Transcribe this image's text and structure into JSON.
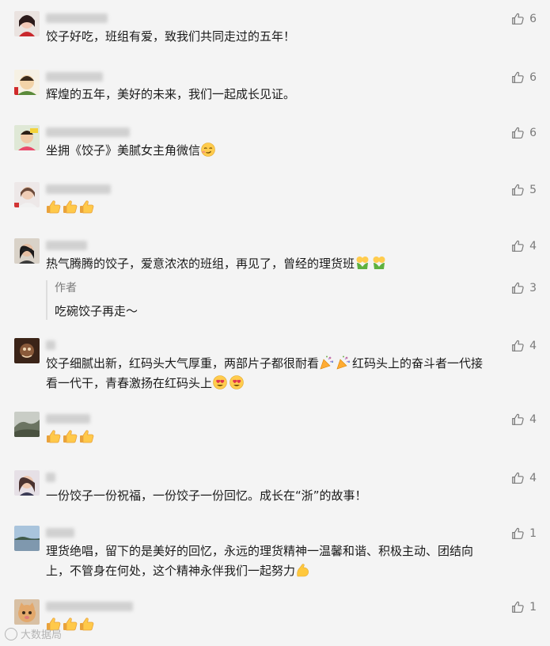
{
  "comments": [
    {
      "likes": "6",
      "text": "饺子好吃，班组有爱，致我们共同走过的五年！"
    },
    {
      "likes": "6",
      "text": "辉煌的五年，美好的未来，我们一起成长见证。"
    },
    {
      "likes": "6",
      "text": "坐拥《饺子》美腻女主角微信"
    },
    {
      "likes": "5",
      "text": ""
    },
    {
      "likes": "4",
      "text": "热气腾腾的饺子，爱意浓浓的班组，再见了，曾经的理货班"
    },
    {
      "likes": "4",
      "text": "饺子细腻出新，红码头大气厚重，两部片子都很耐看",
      "text2": "红码头上的奋斗者一代接",
      "text3": "看一代干，青春激扬在红码头上"
    },
    {
      "likes": "4",
      "text": ""
    },
    {
      "likes": "4",
      "text": "一份饺子一份祝福，一份饺子一份回忆。成长在“浙”的故事！"
    },
    {
      "likes": "1",
      "text": "理货绝唱，留下的是美好的回忆，永远的理货精神一温馨和谐、积极主动、团结向",
      "text2": "上，不管身在何处，这个精神永伴我们一起努力"
    },
    {
      "likes": "1",
      "text": ""
    }
  ],
  "reply": {
    "author": "作者",
    "text": "吃碗饺子再走～",
    "likes": "3"
  },
  "watermark": "大数据局",
  "icons": {
    "like": "thumbs-up-outline-icon",
    "emoji_thumb": "thumbs-up-emoji",
    "emoji_pray": "praying-emoji",
    "emoji_smirk": "smirking-emoji",
    "emoji_party": "party-popper-emoji",
    "emoji_heart_eyes": "heart-eyes-emoji",
    "emoji_muscle": "flexed-biceps-emoji"
  },
  "colors": {
    "text": "#1a1a1a",
    "meta": "#7a7a7a",
    "background": "#f4f4f4"
  }
}
